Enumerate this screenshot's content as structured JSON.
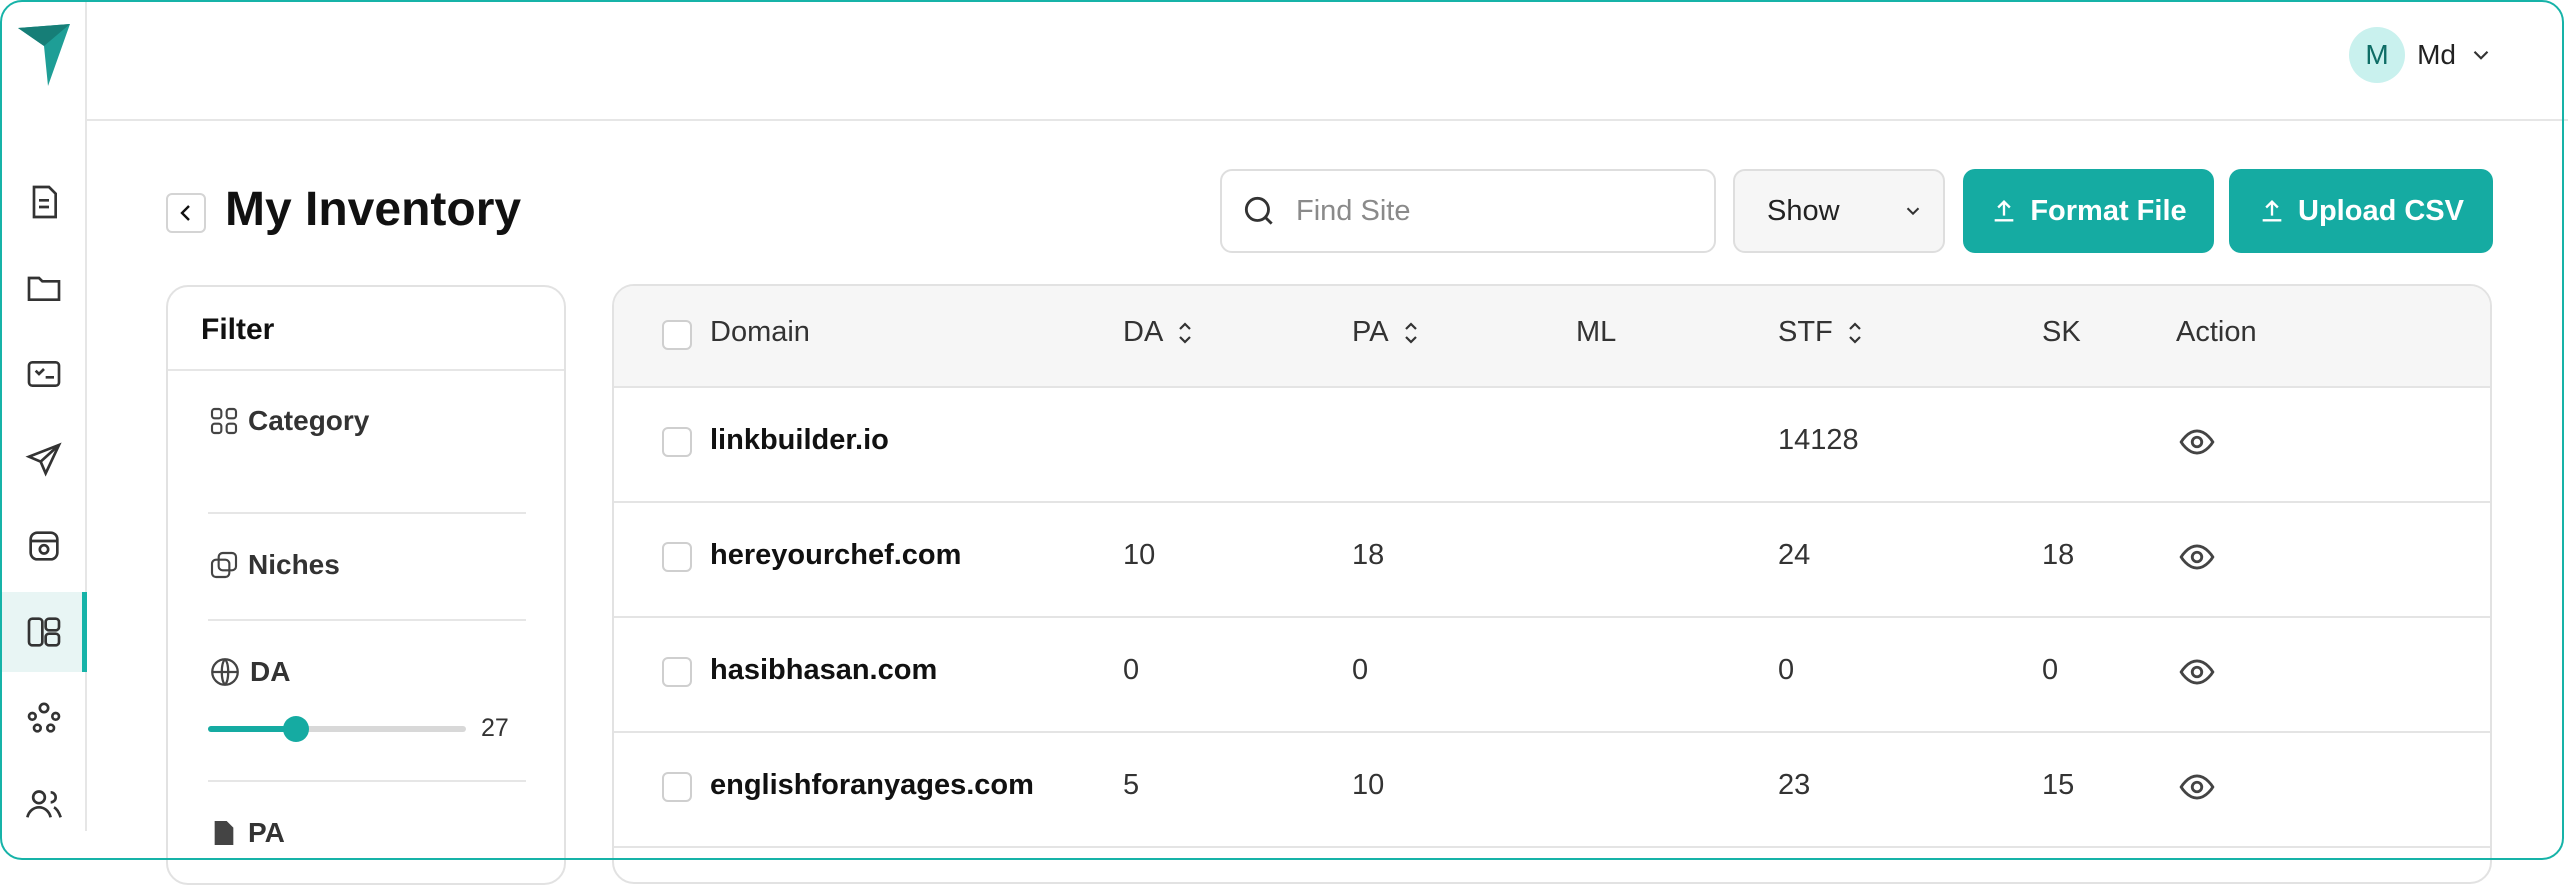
{
  "app": {
    "brand_color": "#16b3a8",
    "logo_icon": "arrow-logo-icon"
  },
  "nav_rail": [
    {
      "icon": "document-icon",
      "active": false
    },
    {
      "icon": "folder-icon",
      "active": false
    },
    {
      "icon": "checklist-icon",
      "active": false
    },
    {
      "icon": "send-icon",
      "active": false
    },
    {
      "icon": "camera-box-icon",
      "active": false
    },
    {
      "icon": "inventory-layout-icon",
      "active": true
    },
    {
      "icon": "network-icon",
      "active": false
    },
    {
      "icon": "users-icon",
      "active": false
    }
  ],
  "user": {
    "initial": "M",
    "name": "Md"
  },
  "page": {
    "title": "My Inventory"
  },
  "search": {
    "placeholder": "Find Site",
    "value": ""
  },
  "show_select": {
    "label": "Show"
  },
  "buttons": {
    "format_file": "Format File",
    "upload_csv": "Upload CSV"
  },
  "filter": {
    "title": "Filter",
    "items": {
      "category": "Category",
      "niches": "Niches",
      "da": "DA",
      "pa": "PA"
    },
    "da_slider": {
      "value": "27",
      "fraction": 0.34
    }
  },
  "table": {
    "columns": {
      "domain": "Domain",
      "da": "DA",
      "pa": "PA",
      "ml": "ML",
      "stf": "STF",
      "sk": "SK",
      "action": "Action"
    },
    "rows": [
      {
        "domain": "linkbuilder.io",
        "da": "",
        "pa": "",
        "ml": "",
        "stf": "14128",
        "sk": ""
      },
      {
        "domain": "hereyourchef.com",
        "da": "10",
        "pa": "18",
        "ml": "",
        "stf": "24",
        "sk": "18"
      },
      {
        "domain": "hasibhasan.com",
        "da": "0",
        "pa": "0",
        "ml": "",
        "stf": "0",
        "sk": "0"
      },
      {
        "domain": "englishforanyages.com",
        "da": "5",
        "pa": "10",
        "ml": "",
        "stf": "23",
        "sk": "15"
      }
    ]
  }
}
